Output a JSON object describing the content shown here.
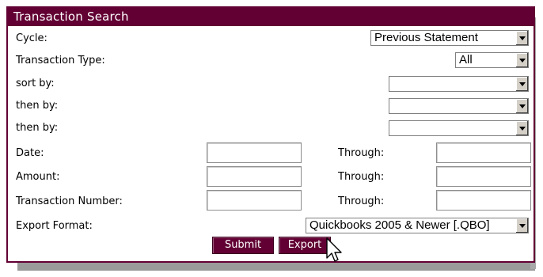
{
  "panel": {
    "title": "Transaction Search"
  },
  "fields": {
    "cycle": {
      "label": "Cycle:",
      "value": "Previous Statement"
    },
    "transaction_type": {
      "label": "Transaction Type:",
      "value": "All"
    },
    "sort_by": {
      "label": "sort by:",
      "value": ""
    },
    "then_by_1": {
      "label": "then by:",
      "value": ""
    },
    "then_by_2": {
      "label": "then by:",
      "value": ""
    },
    "date": {
      "label": "Date:",
      "from": "",
      "through_label": "Through:",
      "to": ""
    },
    "amount": {
      "label": "Amount:",
      "from": "",
      "through_label": "Through:",
      "to": ""
    },
    "transaction_number": {
      "label": "Transaction Number:",
      "from": "",
      "through_label": "Through:",
      "to": ""
    },
    "export_format": {
      "label": "Export Format:",
      "value": "Quickbooks 2005 & Newer [.QBO]"
    }
  },
  "buttons": {
    "submit": "Submit",
    "export": "Export"
  },
  "colors": {
    "brand": "#620033"
  },
  "icons": {
    "cursor": "mouse-pointer-icon",
    "dropdown": "chevron-down-icon"
  }
}
